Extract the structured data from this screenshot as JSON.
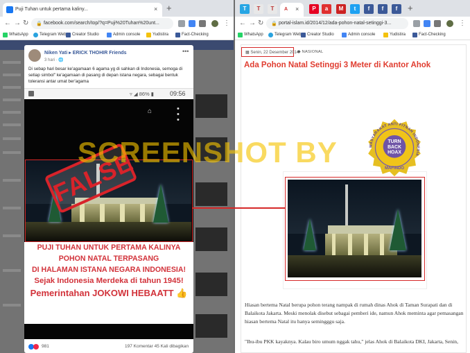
{
  "left_browser": {
    "tab_title": "Puji Tuhan untuk pertama kaliny...",
    "tab_close": "×",
    "new_tab": "+",
    "url": "facebook.com/search/top/?q=Puji%20Tuhan%20unt...",
    "bookmarks": [
      "WhatsApp",
      "Telegram Web",
      "Creator Studio",
      "Admin console",
      "Yudistira",
      "Fact-Checking"
    ]
  },
  "right_browser": {
    "mini_tabs": [
      {
        "letter": "T",
        "color": "#26a5e4"
      },
      {
        "letter": "T",
        "color": "#e8e8e8"
      },
      {
        "letter": "T",
        "color": "#e8e8e8"
      },
      {
        "letter": "A",
        "color": "#ffffff"
      },
      {
        "letter": "P",
        "color": "#e60023"
      },
      {
        "letter": "a",
        "color": "#e03030"
      },
      {
        "letter": "M",
        "color": "#cc2222"
      },
      {
        "letter": "t",
        "color": "#1da1f2"
      },
      {
        "letter": "f",
        "color": "#3b5998"
      },
      {
        "letter": "f",
        "color": "#3b5998"
      },
      {
        "letter": "f",
        "color": "#3b5998"
      }
    ],
    "active_tab_close": "×",
    "new_tab": "+",
    "url": "portal-islam.id/2014/12/ada-pohon-natal-setinggi-3...",
    "bookmarks": [
      "WhatsApp",
      "Telegram Web",
      "Creator Studio",
      "Admin console",
      "Yudistira",
      "Fact-Checking"
    ]
  },
  "fb_post": {
    "author": "Niken Yati ▸ ERICK THOHIR Friends",
    "time": "3 hari · 🌐",
    "more": "•••",
    "caption": "Di sebap hari besar ke'agamaan 6 agama yg di sahkan di Indonesia, semoga di setiap simbol\" ke'agamaan di pasang di depan istana negara, sebagai bentuk toleransi antar umat ber'agama",
    "phone_status": "▿ ◢ 86% ▮",
    "phone_time": "09:56",
    "banner_lines": [
      "PUJI TUHAN UNTUK PERTAMA KALINYA",
      "POHON NATAL TERPASANG",
      "DI HALAMAN ISTANA NEGARA INDONESIA!",
      "Sejak Indonesia Merdeka di tahun 1945!",
      "Pemerintahan JOKOWI HEBAATT 👍"
    ],
    "stamp": "FALSE",
    "reactions_count": "981",
    "stats": "197 Komentar   45 Kali dibagikan"
  },
  "article": {
    "date": "Senin, 22 Desember 2014",
    "category": "NASIONAL",
    "title": "Ada Pohon Natal Setinggi 3 Meter di Kantor Ahok",
    "paragraphs": [
      "Hiasan bertema Natal berupa pohon terang nampak di rumah dinas Ahok di Taman Surapati dan di Balaikota Jakarta. Meski menolak disebut sebagai pemberi ide, namun Ahok meminta agar pemasangan hiasan bertema Natal itu hanya semingggu saja.",
      "\"Ibu-ibu PKK kayaknya. Kalau biro umum nggak tahu,\" jelas Ahok di Balaikota DKI, Jakarta, Senin,"
    ]
  },
  "watermark": "SCREENSHOT BY",
  "seal": {
    "ring_text": "MASYARAKAT ANTI FITNAH INDONESIA",
    "center_lines": [
      "TURN",
      "BACK",
      "HOAX"
    ],
    "bottom": "MAFINDO"
  }
}
